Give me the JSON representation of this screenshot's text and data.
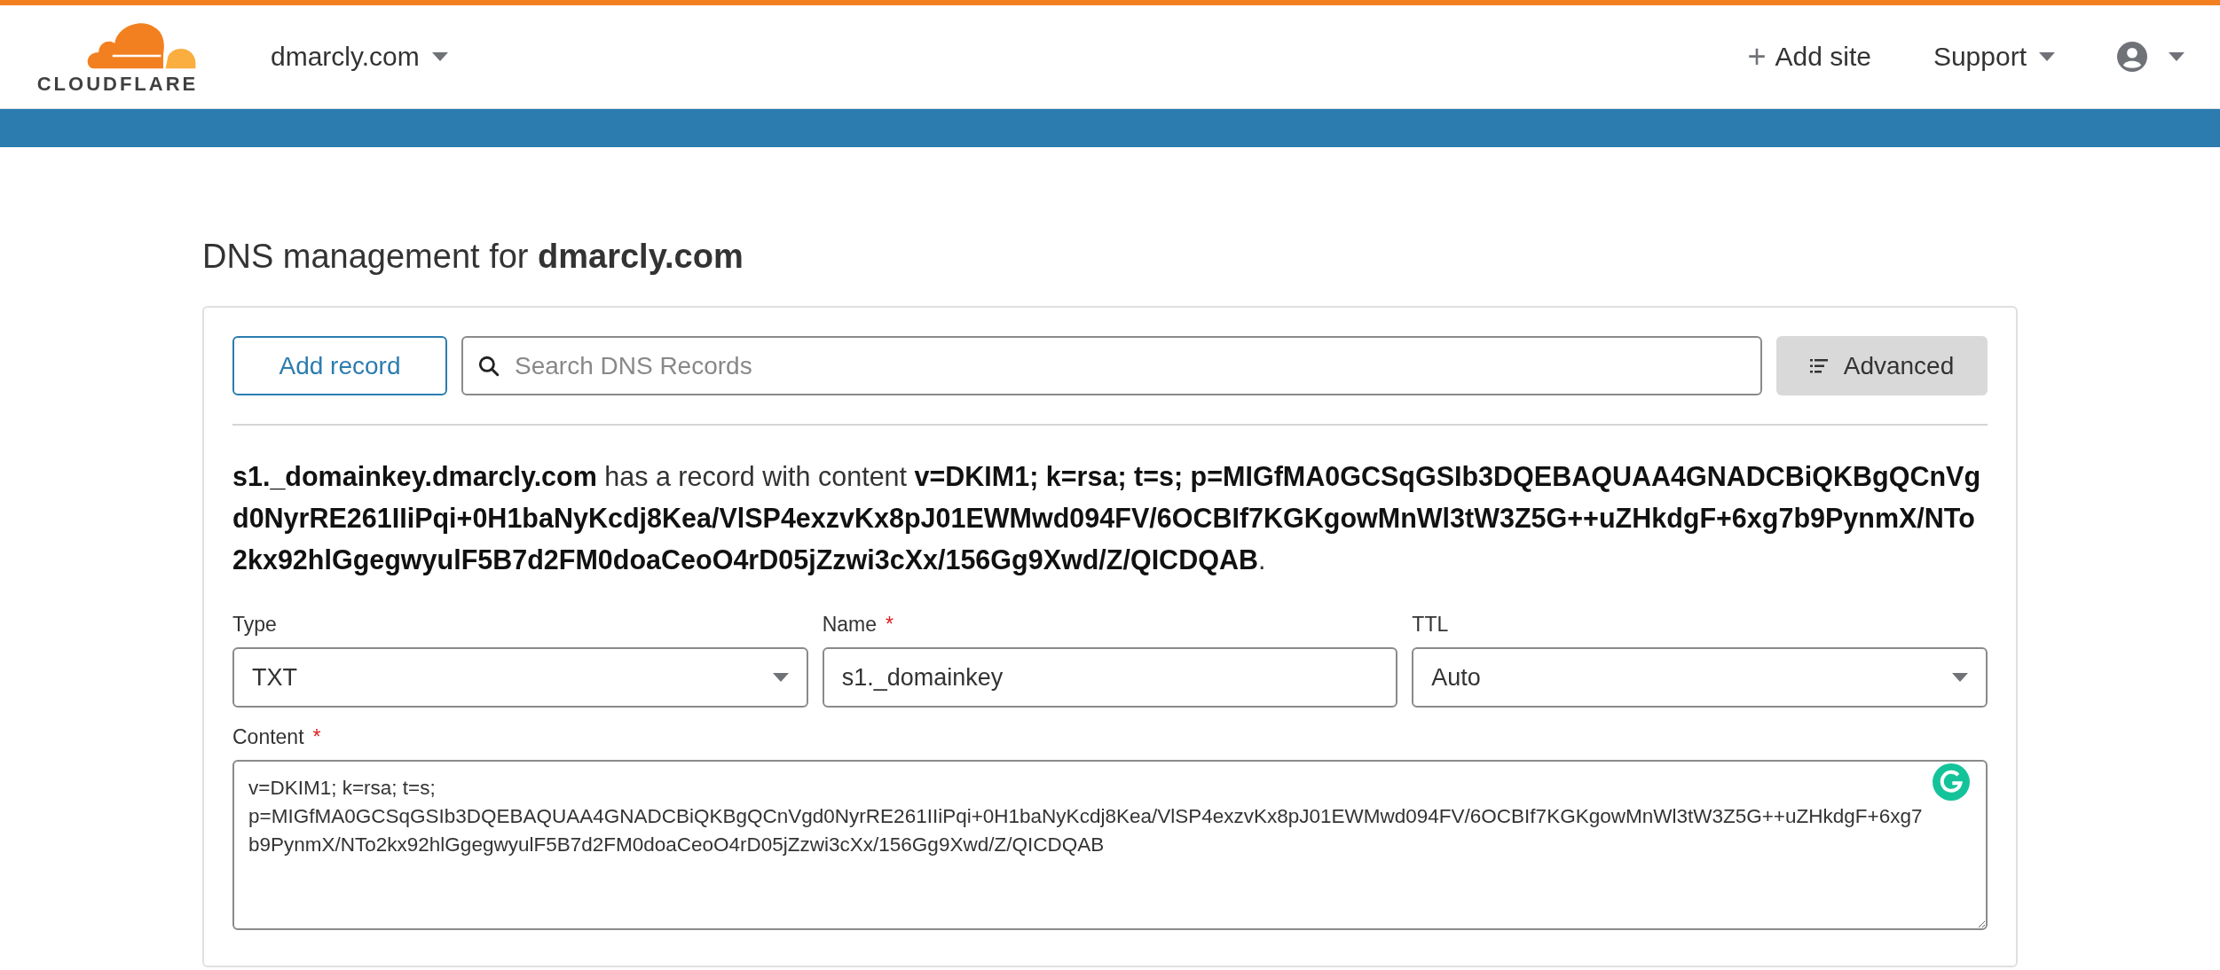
{
  "header": {
    "logo_text": "CLOUDFLARE",
    "site_menu": "dmarcly.com",
    "add_site": {
      "icon": "+",
      "label": "Add site"
    },
    "support_menu": "Support"
  },
  "page": {
    "title": "DNS management for **dmarcly.com**"
  },
  "toolbar": {
    "add_button": "Add record",
    "search": {
      "placeholder": "Search DNS Records"
    },
    "advanced_button": "Advanced"
  },
  "record_summary": "**s1._domainkey.dmarcly.com** has a record with content **v=DKIM1; k=rsa; t=s; p=MIGfMA0GCSqGSIb3DQEBAQUAA4GNADCBiQKBgQCnVgd0NyrRE261IIiPqi+0H1baNyKcdj8Kea/VlSP4exzvKx8pJ01EWMwd094FV/6OCBIf7KGKgowMnWl3tW3Z5G++uZHkdgF+6xg7b9PynmX/NTo2kx92hlGgegwyulF5B7d2FM0doaCeoO4rD05jZzwi3cXx/156Gg9Xwd/Z/QICDQAB**.",
  "fields": [
    {
      "kind": "select",
      "label": "Type",
      "value": "TXT"
    },
    {
      "kind": "text",
      "label": "Name",
      "required_mark": "*",
      "value": "s1._domainkey"
    },
    {
      "kind": "select",
      "label": "TTL",
      "value": "Auto"
    }
  ],
  "content": {
    "label": "Content",
    "required_mark": "*",
    "value": "v=DKIM1; k=rsa; t=s; p=MIGfMA0GCSqGSIb3DQEBAQUAA4GNADCBiQKBgQCnVgd0NyrRE261IIiPqi+0H1baNyKcdj8Kea/VlSP4exzvKx8pJ01EWMwd094FV/6OCBIf7KGKgowMnWl3tW3Z5G++uZHkdgF+6xg7b9PynmX/NTo2kx92hlGgegwyulF5B7d2FM0doaCeoO4rD05jZzwi3cXx/156Gg9Xwd/Z/QICDQAB"
  }
}
